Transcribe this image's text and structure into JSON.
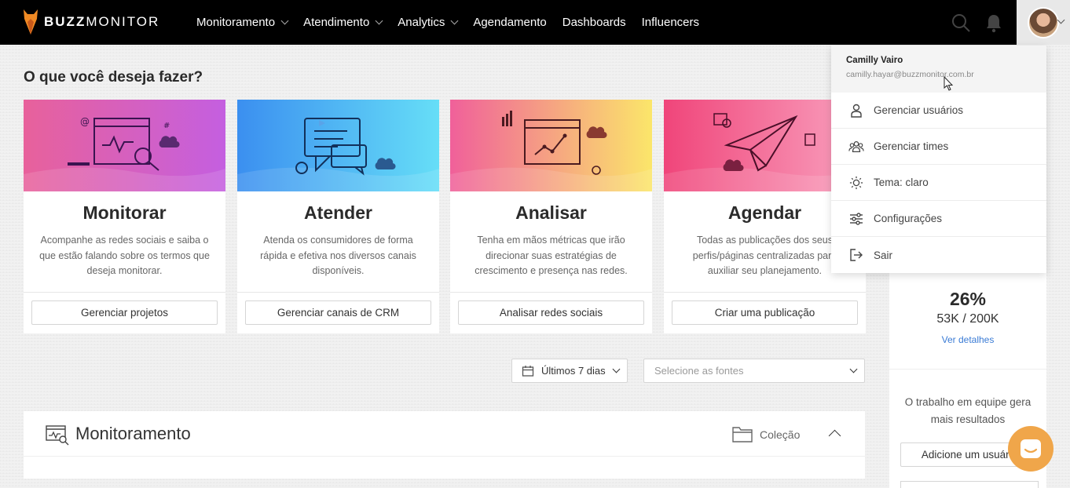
{
  "app": {
    "logo_bold": "BUZZ",
    "logo_light": "MONITOR"
  },
  "nav": {
    "items": [
      {
        "label": "Monitoramento",
        "dropdown": true
      },
      {
        "label": "Atendimento",
        "dropdown": true
      },
      {
        "label": "Analytics",
        "dropdown": true
      },
      {
        "label": "Agendamento",
        "dropdown": false
      },
      {
        "label": "Dashboards",
        "dropdown": false
      },
      {
        "label": "Influencers",
        "dropdown": false
      }
    ],
    "icons": [
      "search-icon",
      "bell-icon"
    ]
  },
  "page": {
    "title": "O que você deseja fazer?"
  },
  "cards": [
    {
      "title": "Monitorar",
      "desc": "Acompanhe as redes sociais e saiba o que estão falando sobre os termos que deseja monitorar.",
      "button": "Gerenciar projetos",
      "gradient": [
        "#e8619b",
        "#c45fe0"
      ]
    },
    {
      "title": "Atender",
      "desc": "Atenda os consumidores de forma rápida e efetiva nos diversos canais disponíveis.",
      "button": "Gerenciar canais de CRM",
      "gradient": [
        "#3b8ff0",
        "#66def7"
      ]
    },
    {
      "title": "Analisar",
      "desc": "Tenha em mãos métricas que irão direcionar suas estratégias de crescimento e presença nas redes.",
      "button": "Analisar redes sociais",
      "gradient": [
        "#f0609a",
        "#fbe66a"
      ]
    },
    {
      "title": "Agendar",
      "desc": "Todas as publicações dos seus perfis/páginas centralizadas para auxiliar seu planejamento.",
      "button": "Criar uma publicação",
      "gradient": [
        "#f0457a",
        "#f9a3c0"
      ]
    }
  ],
  "filters": {
    "date_label": "Últimos 7 dias",
    "source_placeholder": "Selecione as fontes"
  },
  "section": {
    "title": "Monitoramento",
    "collection_label": "Coleção"
  },
  "right_panel": {
    "percent": "26%",
    "count": "53K / 200K",
    "details_link": "Ver detalhes",
    "team_text": "O trabalho em equipe gera mais resultados",
    "add_user_button": "Adicione um usuário"
  },
  "user_menu": {
    "name": "Camilly Vairo",
    "email": "camilly.hayar@buzzmonitor.com.br",
    "items": [
      {
        "label": "Gerenciar usuários",
        "icon": "user-icon"
      },
      {
        "label": "Gerenciar times",
        "icon": "team-icon"
      },
      {
        "label": "Tema: claro",
        "icon": "sun-icon"
      },
      {
        "label": "Configurações",
        "icon": "sliders-icon"
      },
      {
        "label": "Sair",
        "icon": "logout-icon"
      }
    ]
  },
  "colors": {
    "navbar": "#000000",
    "accent_link": "#3a7bd5",
    "chat": "#f0a64a"
  }
}
